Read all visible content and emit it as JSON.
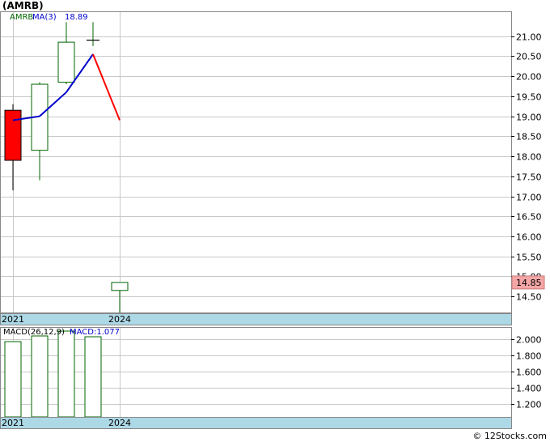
{
  "header": {
    "title": "(AMRB)",
    "credit": "© 12Stocks.com"
  },
  "colors": {
    "up": "#006400",
    "down": "#ff0000",
    "ma": "#0000cc",
    "grid": "#c8c8c8",
    "axis_band": "#add8e6",
    "last_price_box": "#f4a6a6"
  },
  "chart_data": [
    {
      "type": "candlestick",
      "title": "",
      "legend": {
        "symbol": "AMRB",
        "ma_label": "MA(3)",
        "ma_value": "18.89"
      },
      "ylim": [
        14.1,
        21.6
      ],
      "yticks": [
        14.5,
        15.0,
        15.5,
        16.0,
        16.5,
        17.0,
        17.5,
        18.0,
        18.5,
        19.0,
        19.5,
        20.0,
        20.5,
        21.0
      ],
      "ytick_labels": [
        "14.50",
        "15.00",
        "15.50",
        "16.00",
        "16.50",
        "17.00",
        "17.50",
        "18.00",
        "18.50",
        "19.00",
        "19.50",
        "20.00",
        "20.50",
        "21.00"
      ],
      "last_price": "14.85",
      "x_labels": [
        {
          "index": 0,
          "label": "2021"
        },
        {
          "index": 4,
          "label": "2024"
        }
      ],
      "candles": [
        {
          "open": 19.15,
          "high": 19.3,
          "low": 17.15,
          "close": 17.9
        },
        {
          "open": 18.15,
          "high": 19.85,
          "low": 17.4,
          "close": 19.8
        },
        {
          "open": 19.85,
          "high": 21.35,
          "low": 19.8,
          "close": 20.85
        },
        {
          "open": 20.9,
          "high": 21.35,
          "low": 20.75,
          "close": 20.9
        },
        {
          "open": 14.65,
          "high": 14.85,
          "low": 14.1,
          "close": 14.85
        }
      ],
      "ma": [
        18.9,
        19.0,
        19.6,
        20.55,
        18.9
      ]
    },
    {
      "type": "bar",
      "title": "",
      "legend": {
        "label": "MACD(26,12,9)",
        "macd_label": "MACD:1.077"
      },
      "ylim": [
        1.04,
        2.14
      ],
      "yticks": [
        1.2,
        1.4,
        1.6,
        1.8,
        2.0
      ],
      "ytick_labels": [
        "1.200",
        "1.400",
        "1.600",
        "1.800",
        "2.000"
      ],
      "x_labels": [
        {
          "index": 0,
          "label": "2021"
        },
        {
          "index": 4,
          "label": "2024"
        }
      ],
      "values": [
        1.97,
        2.04,
        2.1,
        2.03
      ]
    }
  ]
}
